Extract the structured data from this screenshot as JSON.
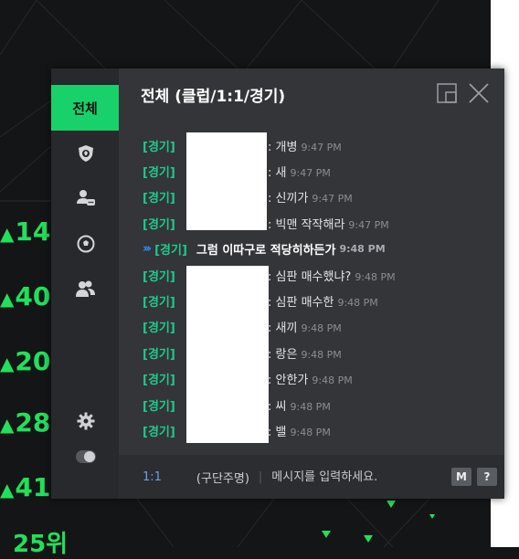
{
  "background": {
    "values": [
      "14",
      "40",
      "20",
      "28",
      "41"
    ],
    "bottom_text": "25위"
  },
  "chat": {
    "title": "전체 (클럽/1:1/경기)",
    "tab_all": "전체",
    "sidebar_icons": [
      "club-shield-icon",
      "user-chat-icon",
      "soccer-ball-icon",
      "friends-icon"
    ],
    "settings_icon": "gear-icon",
    "toggle_icon": "toggle-icon",
    "messages": [
      {
        "tag": "[경기]",
        "text": "개병",
        "time": "9:47 PM"
      },
      {
        "tag": "[경기]",
        "text": "새",
        "time": "9:47 PM"
      },
      {
        "tag": "[경기]",
        "text": "신끼가",
        "time": "9:47 PM"
      },
      {
        "tag": "[경기]",
        "text": "빅맨 작작해라",
        "time": "9:47 PM"
      },
      {
        "tag": "[경기]",
        "text": "그럼 이따구로 적당히하든가",
        "time": "9:48 PM",
        "highlight": true
      },
      {
        "tag": "[경기]",
        "text": "심판 매수했냐?",
        "time": "9:48 PM"
      },
      {
        "tag": "[경기]",
        "text": "심판 매수한",
        "time": "9:48 PM"
      },
      {
        "tag": "[경기]",
        "text": "새끼",
        "time": "9:48 PM"
      },
      {
        "tag": "[경기]",
        "text": "랑은",
        "time": "9:48 PM"
      },
      {
        "tag": "[경기]",
        "text": "안한가",
        "time": "9:48 PM"
      },
      {
        "tag": "[경기]",
        "text": "씨",
        "time": "9:48 PM"
      },
      {
        "tag": "[경기]",
        "text": "밸",
        "time": "9:48 PM"
      }
    ],
    "input": {
      "mode": "1:1",
      "speaker": "(구단주명)",
      "placeholder": "메시지를 입력하세요.",
      "btn_m": "M",
      "btn_help": "?"
    },
    "colors": {
      "accent": "#18d16a",
      "tag": "#20c98a",
      "highlight_arrow": "#2a8be8"
    }
  }
}
